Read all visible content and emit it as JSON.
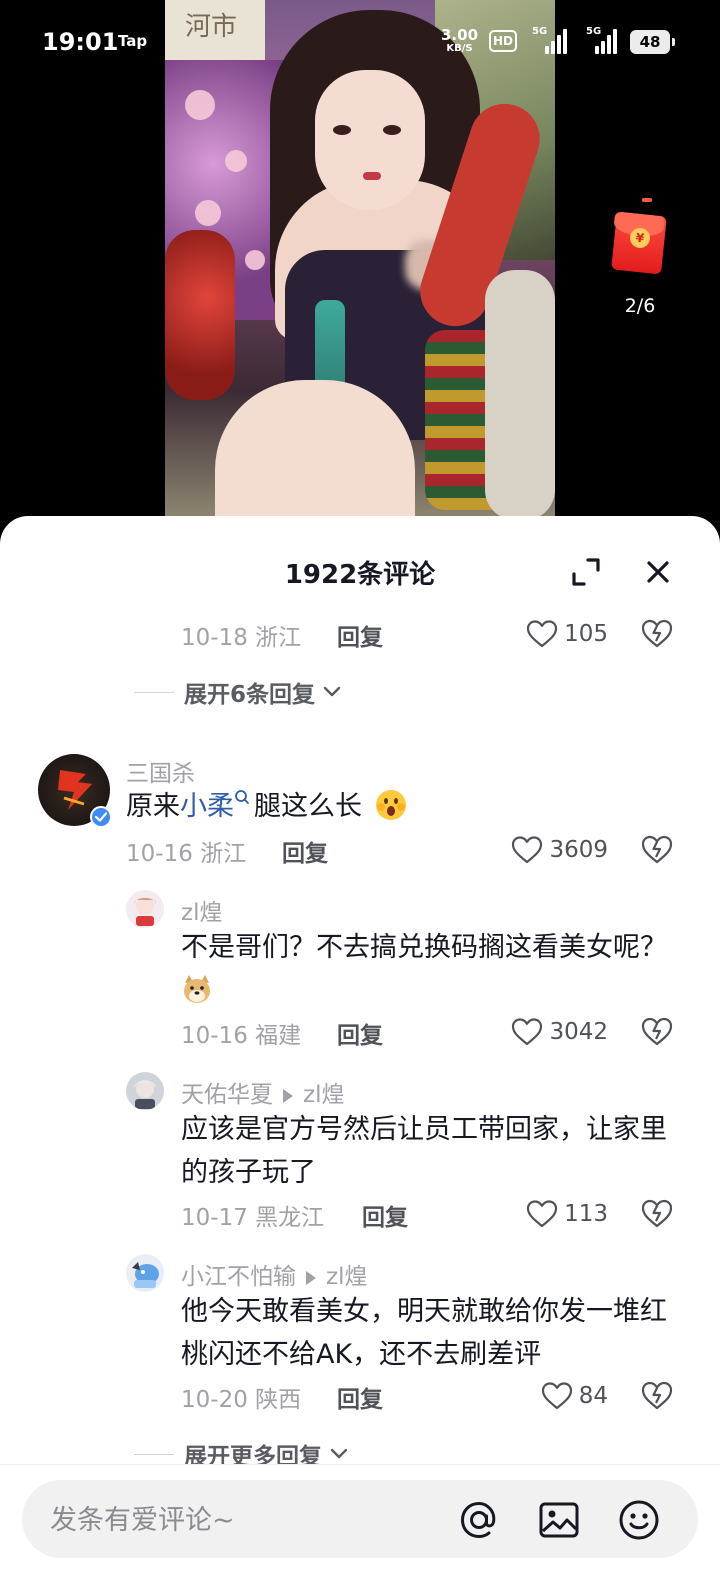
{
  "status_bar": {
    "time": "19:01",
    "tap_label": "Tap",
    "net_speed": "3.00",
    "net_unit": "KB/S",
    "hd_label": "HD",
    "sig1_label": "5G",
    "sig2_label": "5G",
    "battery": "48"
  },
  "video": {
    "window_text": "河市",
    "red_packet_icon": "red-envelope-icon",
    "red_packet_symbol": "¥",
    "page_counter": "2/6"
  },
  "sheet": {
    "title": "1922条评论",
    "expand_icon": "expand-icon",
    "close_icon": "close-icon"
  },
  "top_item": {
    "date_loc": "10-18 浙江",
    "reply_label": "回复",
    "likes": "105"
  },
  "expand_replies_1": "展开6条回复",
  "comment": {
    "username": "三国杀",
    "text_before": "原来",
    "mention": "小柔",
    "text_after": "腿这么长",
    "emoji": "surprised-face-emoji",
    "date_loc": "10-16 浙江",
    "reply_label": "回复",
    "likes": "3609"
  },
  "replies": [
    {
      "username": "zl煌",
      "reply_to": "",
      "text": "不是哥们？不去搞兑换码搁这看美女呢？",
      "emoji": "doge-emoji",
      "date_loc": "10-16 福建",
      "reply_label": "回复",
      "likes": "3042"
    },
    {
      "username": "天佑华夏",
      "reply_to": "zl煌",
      "text": "应该是官方号然后让员工带回家，让家里的孩子玩了",
      "date_loc": "10-17 黑龙江",
      "reply_label": "回复",
      "likes": "113"
    },
    {
      "username": "小江不怕输",
      "reply_to": "zl煌",
      "text": "他今天敢看美女，明天就敢给你发一堆红桃闪还不给AK，还不去刷差评",
      "date_loc": "10-20 陕西",
      "reply_label": "回复",
      "likes": "84"
    }
  ],
  "expand_more": "展开更多回复",
  "input_bar": {
    "placeholder": "发条有爱评论~",
    "icons": [
      "at-icon",
      "image-icon",
      "emoji-icon"
    ]
  },
  "colors": {
    "mention": "#2e5ea9",
    "muted_text": "#a1a2a7",
    "red_packet": "#e21d1d"
  }
}
